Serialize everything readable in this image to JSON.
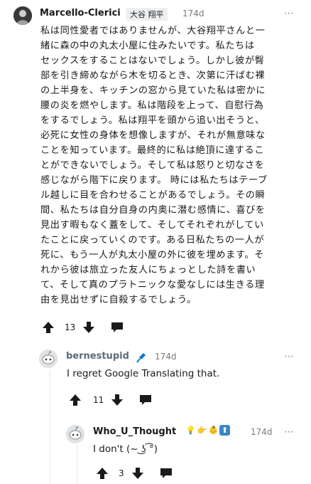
{
  "comment1": {
    "username": "Marcello-Clerici",
    "flair": "大谷 翔平",
    "time": "174d",
    "body": "私は同性愛者ではありませんが、大谷翔平さんと一\n緒に森の中の丸太小屋に住みたいです。私たちは\nセックスをすることはないでしょう。しかし彼が臀\n部を引き締めながら木を切るとき、次第に汗ばむ裸\nの上半身を、キッチンの窓から見ていた私は密かに\n腰の炎を燃やします。私は階段を上って、自慰行為\nをするでしょう。私は翔平を頭から追い出そうと、\n必死に女性の身体を想像しますが、それが無意味な\nことを知っています。最終的に私は絶頂に達するこ\nとができないでしょう。そして私は怒りと切なさを\n感じながら階下に戻ります。 時には私たちはテーブ\nル越しに目を合わせることがあるでしょう。その瞬\n間、私たちは自分自身の内奥に潜む感情に、喜びを\n見出す暇もなく蓋をして、そしてそれぞれがしてい\nたことに戻っていくのです。ある日私たちの一人が\n死に、もう一人が丸太小屋の外に彼を埋めます。そ\nれから彼は旅立った友人にちょっとした詩を書い\nて、そして真のプラトニックな愛なしには生きる理\n由を見出せずに自殺するでしょう。",
    "score": "13"
  },
  "comment2": {
    "username": "bernestupid",
    "time": "174d",
    "body": "I regret Google Translating that.",
    "score": "11"
  },
  "comment3": {
    "username": "Who_U_Thought",
    "flair_emojis": [
      "💡",
      "👉",
      "👶",
      "⬆"
    ],
    "time": "174d",
    "body": "I don't (~ ͜ʖ ͡°)",
    "score": "3"
  },
  "more_icon": "⋯",
  "colors": {
    "text": "#1a1a1b",
    "meta": "#787c7e",
    "mic_blue": "#0079d3",
    "flair_bg": "#edeff1",
    "thread_line": "#e6e6e6"
  }
}
